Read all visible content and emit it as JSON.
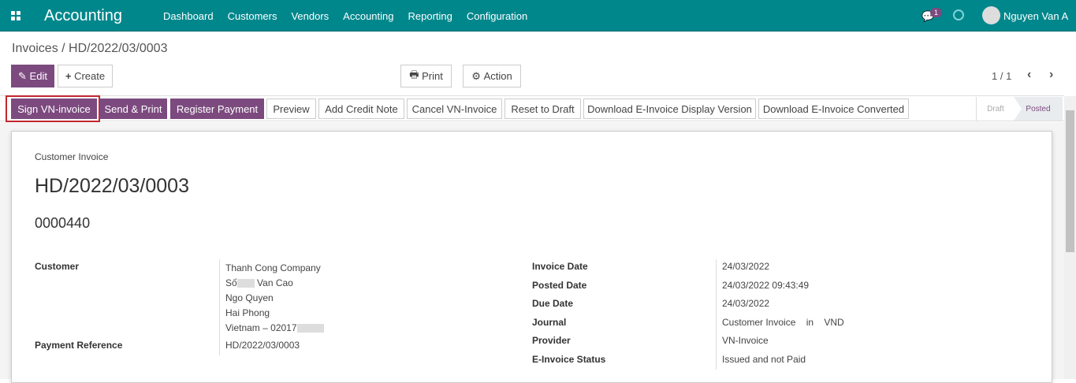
{
  "navbar": {
    "app": "Accounting",
    "menu": [
      "Dashboard",
      "Customers",
      "Vendors",
      "Accounting",
      "Reporting",
      "Configuration"
    ],
    "message_count": "1",
    "user": "Nguyen Van A",
    "color": "#00878c"
  },
  "breadcrumb": {
    "parent": "Invoices",
    "current": "HD/2022/03/0003"
  },
  "toolbar": {
    "edit": "Edit",
    "create": "Create",
    "print": "Print",
    "action": "Action",
    "pager": "1 / 1"
  },
  "statusbar": {
    "buttons": [
      "Sign VN-invoice",
      "Send & Print",
      "Register Payment",
      "Preview",
      "Add Credit Note",
      "Cancel VN-Invoice",
      "Reset to Draft",
      "Download E-Invoice Display Version",
      "Download E-Invoice Converted"
    ],
    "stages": [
      "Draft",
      "Posted"
    ],
    "active_stage": "Posted",
    "accent": "#7c4a7f"
  },
  "form": {
    "type": "Customer Invoice",
    "name": "HD/2022/03/0003",
    "number": "0000440",
    "customer_label": "Customer",
    "customer": [
      "Thanh Cong Company",
      "Số",
      "Van Cao",
      "Ngo Quyen",
      "Hai Phong",
      "Vietnam – 02017"
    ],
    "payment_ref_label": "Payment Reference",
    "payment_ref": "HD/2022/03/0003",
    "right": [
      {
        "label": "Invoice Date",
        "value": "24/03/2022"
      },
      {
        "label": "Posted Date",
        "value": "24/03/2022 09:43:49"
      },
      {
        "label": "Due Date",
        "value": "24/03/2022"
      },
      {
        "label": "Journal",
        "value": "Customer Invoice    in    VND"
      },
      {
        "label": "Provider",
        "value": "VN-Invoice"
      },
      {
        "label": "E-Invoice Status",
        "value": "Issued and not Paid"
      }
    ]
  }
}
